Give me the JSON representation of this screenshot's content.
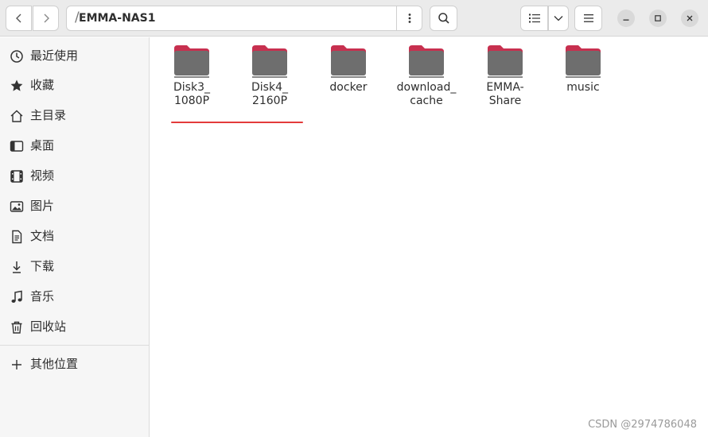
{
  "header": {
    "path": {
      "separator": "/",
      "location": "EMMA-NAS1"
    }
  },
  "sidebar": {
    "items": [
      {
        "label": "最近使用",
        "icon": "clock-icon"
      },
      {
        "label": "收藏",
        "icon": "star-icon"
      },
      {
        "label": "主目录",
        "icon": "home-icon"
      },
      {
        "label": "桌面",
        "icon": "desktop-icon"
      },
      {
        "label": "视频",
        "icon": "film-icon"
      },
      {
        "label": "图片",
        "icon": "image-icon"
      },
      {
        "label": "文档",
        "icon": "document-icon"
      },
      {
        "label": "下载",
        "icon": "download-icon"
      },
      {
        "label": "音乐",
        "icon": "music-icon"
      },
      {
        "label": "回收站",
        "icon": "trash-icon"
      }
    ],
    "other_locations": {
      "label": "其他位置",
      "icon": "plus-icon"
    }
  },
  "content": {
    "folders": [
      {
        "line1": "Disk3_",
        "line2": "1080P"
      },
      {
        "line1": "Disk4_",
        "line2": "2160P"
      },
      {
        "line1": "docker",
        "line2": ""
      },
      {
        "line1": "download_",
        "line2": "cache"
      },
      {
        "line1": "EMMA-",
        "line2": "Share"
      },
      {
        "line1": "music",
        "line2": ""
      }
    ],
    "folder_colors": {
      "tab": "#c7304f",
      "body": "#6e6e6e",
      "base": "#8a8a8a"
    },
    "annotation_color": "#e33b3b"
  },
  "watermark": "CSDN @2974786048"
}
